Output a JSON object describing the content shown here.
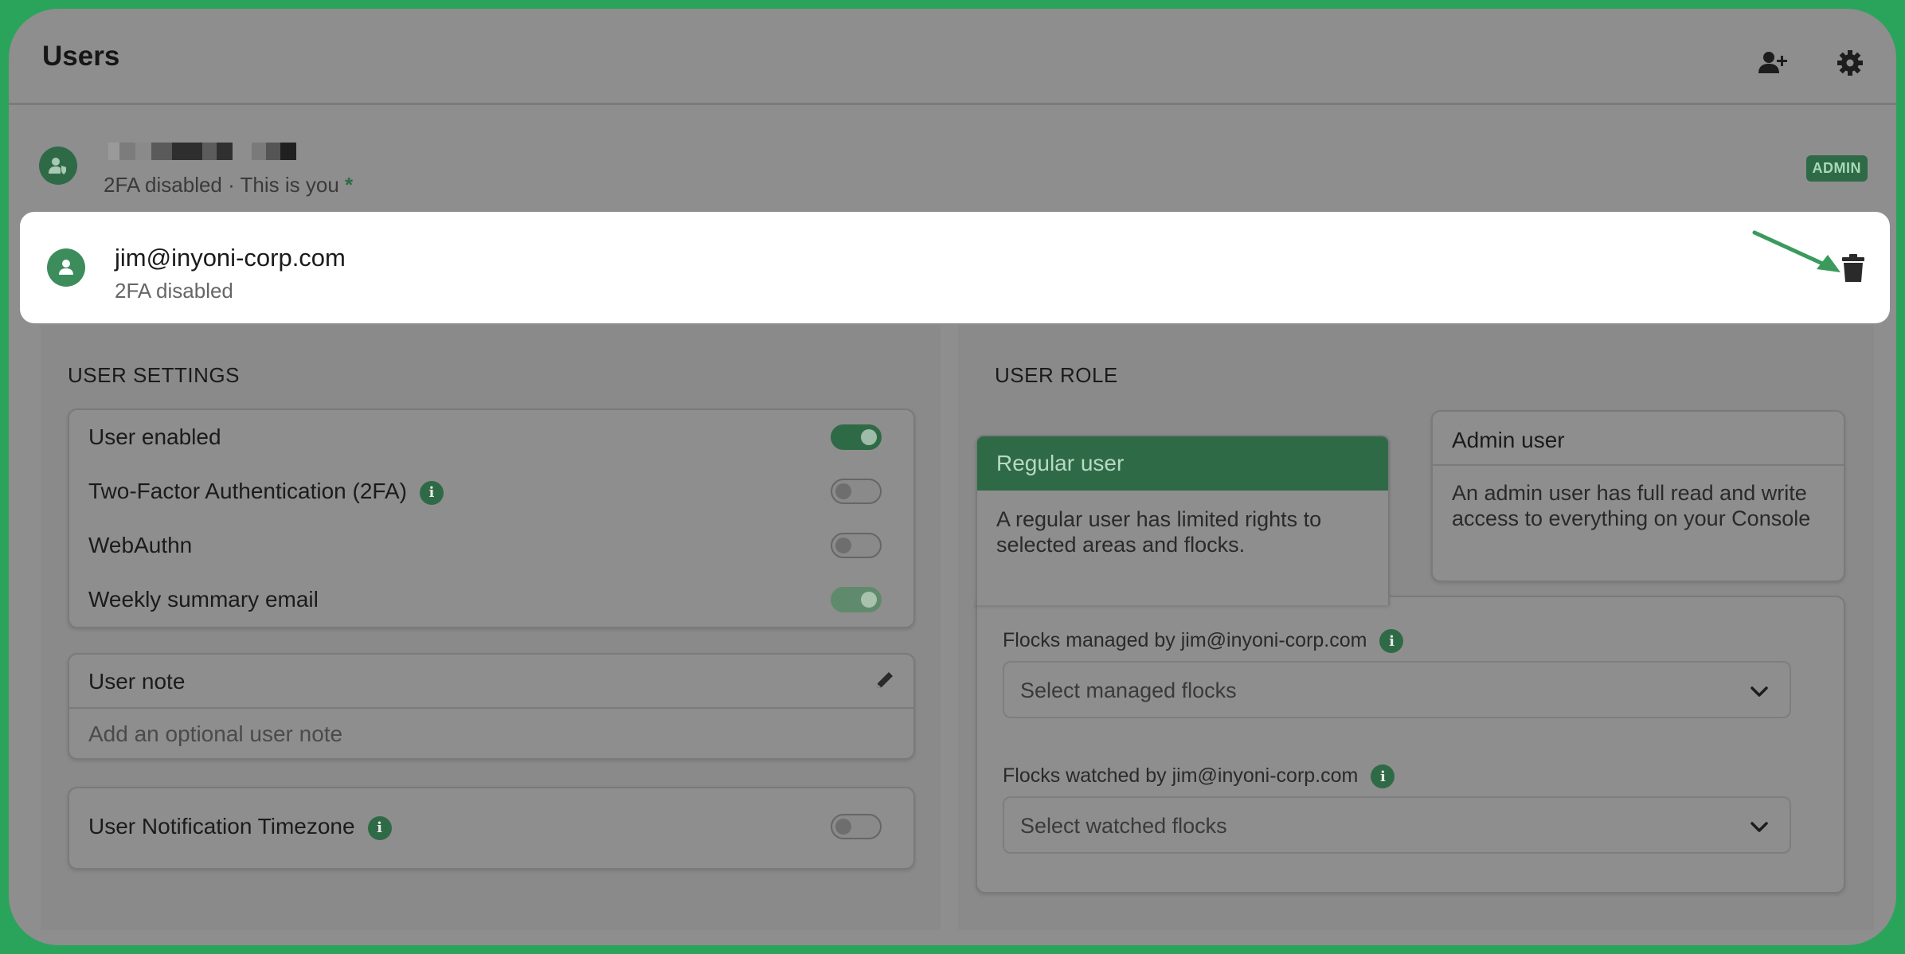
{
  "header": {
    "title": "Users",
    "add_user_icon": "user-plus-icon",
    "settings_icon": "gear-icon"
  },
  "current_user": {
    "status": "2FA disabled · This is you",
    "marker": "*",
    "badge": "ADMIN"
  },
  "selected_user": {
    "email": "jim@inyoni-corp.com",
    "status": "2FA disabled",
    "delete_icon": "trash-icon"
  },
  "user_settings": {
    "section_title": "USER SETTINGS",
    "toggles": [
      {
        "label": "User enabled",
        "state": "on"
      },
      {
        "label": "Two-Factor Authentication (2FA)",
        "state": "off",
        "info": "i"
      },
      {
        "label": "WebAuthn",
        "state": "off"
      },
      {
        "label": "Weekly summary email",
        "state": "on"
      }
    ],
    "note": {
      "title": "User note",
      "placeholder": "Add an optional user note"
    },
    "timezone": {
      "label": "User Notification Timezone",
      "info": "i",
      "state": "off"
    }
  },
  "user_role": {
    "section_title": "USER ROLE",
    "regular": {
      "title": "Regular user",
      "description": "A regular user has limited rights to selected areas and flocks.",
      "selected": true
    },
    "admin": {
      "title": "Admin user",
      "description": "An admin user has full read and write access to everything on your Console"
    },
    "managed": {
      "label": "Flocks managed by jim@inyoni-corp.com",
      "info": "i",
      "placeholder": "Select managed flocks"
    },
    "watched": {
      "label": "Flocks watched by jim@inyoni-corp.com",
      "info": "i",
      "placeholder": "Select watched flocks"
    }
  },
  "colors": {
    "brand_green": "#2f6a46",
    "outer_border": "#2aa45a",
    "overlay_gray": "#8e8e8e"
  }
}
